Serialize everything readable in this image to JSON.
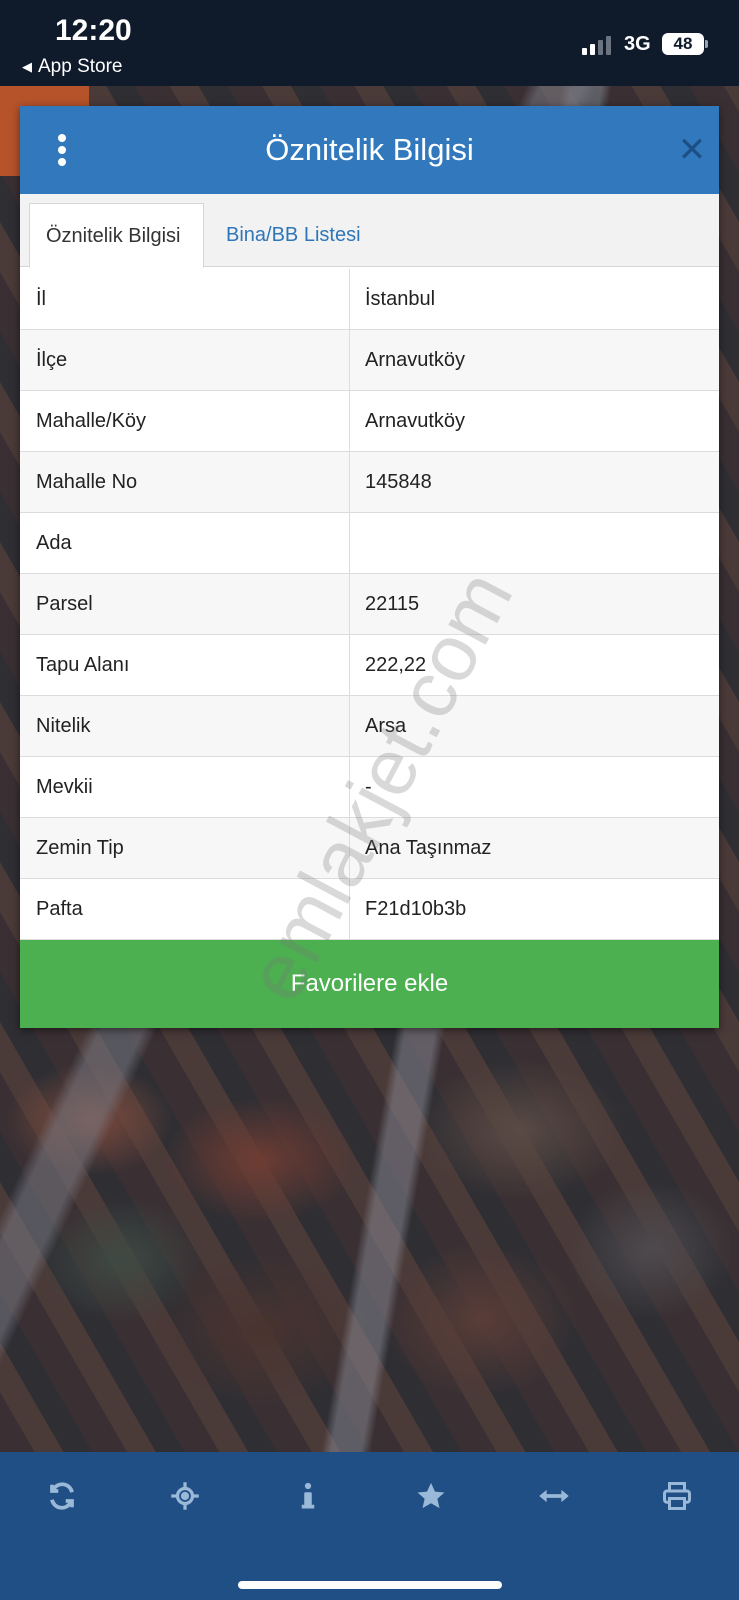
{
  "status_bar": {
    "time": "12:20",
    "back_label": "App Store",
    "network": "3G",
    "battery": "48"
  },
  "dialog": {
    "title": "Öznitelik Bilgisi",
    "tabs": [
      {
        "label": "Öznitelik Bilgisi",
        "active": true
      },
      {
        "label": "Bina/BB Listesi",
        "active": false
      }
    ],
    "rows": [
      {
        "key": "İl",
        "value": "İstanbul"
      },
      {
        "key": "İlçe",
        "value": "Arnavutköy"
      },
      {
        "key": "Mahalle/Köy",
        "value": "Arnavutköy"
      },
      {
        "key": "Mahalle No",
        "value": "145848"
      },
      {
        "key": "Ada",
        "value": ""
      },
      {
        "key": "Parsel",
        "value": "22115"
      },
      {
        "key": "Tapu Alanı",
        "value": "222,22"
      },
      {
        "key": "Nitelik",
        "value": "Arsa"
      },
      {
        "key": "Mevkii",
        "value": "-"
      },
      {
        "key": "Zemin Tip",
        "value": "Ana Taşınmaz"
      },
      {
        "key": "Pafta",
        "value": "F21d10b3b"
      }
    ],
    "favorite_button": "Favorilere ekle"
  },
  "watermark": "emlakjet.com",
  "toolbar": {
    "icons": [
      "refresh-icon",
      "locate-icon",
      "info-icon",
      "star-icon",
      "measure-icon",
      "print-icon"
    ]
  },
  "colors": {
    "header": "#3179bc",
    "favorite_button": "#4caf50",
    "toolbar": "#1f4f84",
    "tab_link": "#2f76b8"
  }
}
